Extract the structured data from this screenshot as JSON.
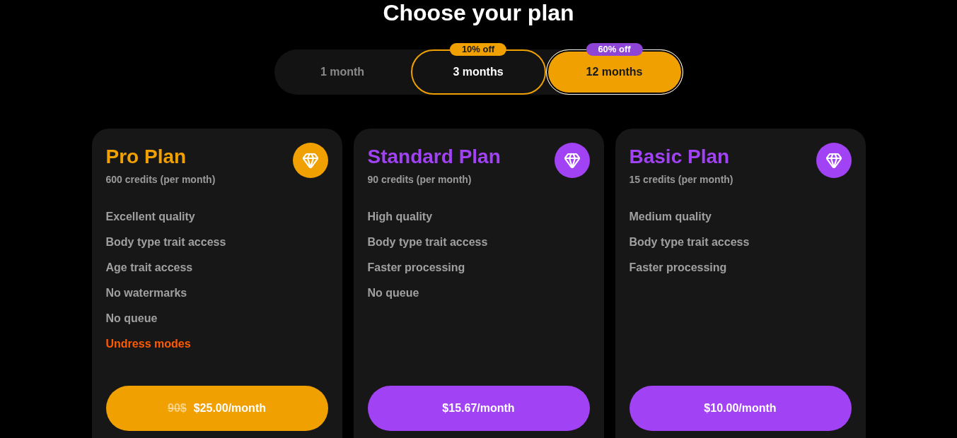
{
  "title": "Choose your plan",
  "billing_periods": [
    {
      "label": "1 month",
      "selected": false,
      "hovered": false
    },
    {
      "label": "3 months",
      "selected": false,
      "hovered": true,
      "badge": {
        "text": "10% off",
        "color": "#f0a000"
      }
    },
    {
      "label": "12 months",
      "selected": true,
      "hovered": false,
      "badge": {
        "text": "60% off",
        "color": "#8e44d6"
      }
    }
  ],
  "plans": [
    {
      "name": "Pro Plan",
      "color": "#f0a000",
      "credits": "600 credits (per month)",
      "features": [
        {
          "text": "Excellent quality",
          "highlighted": false
        },
        {
          "text": "Body type trait access",
          "highlighted": false
        },
        {
          "text": "Age trait access",
          "highlighted": false
        },
        {
          "text": "No watermarks",
          "highlighted": false
        },
        {
          "text": "No queue",
          "highlighted": false
        },
        {
          "text": "Undress modes",
          "highlighted": true
        }
      ],
      "price": {
        "original": "90$",
        "current": "$25.00/month"
      }
    },
    {
      "name": "Standard Plan",
      "color": "#a142f4",
      "credits": "90 credits (per month)",
      "features": [
        {
          "text": "High quality",
          "highlighted": false
        },
        {
          "text": "Body type trait access",
          "highlighted": false
        },
        {
          "text": "Faster processing",
          "highlighted": false
        },
        {
          "text": "No queue",
          "highlighted": false
        }
      ],
      "price": {
        "current": "$15.67/month"
      }
    },
    {
      "name": "Basic Plan",
      "color": "#a142f4",
      "credits": "15 credits (per month)",
      "features": [
        {
          "text": "Medium quality",
          "highlighted": false
        },
        {
          "text": "Body type trait access",
          "highlighted": false
        },
        {
          "text": "Faster processing",
          "highlighted": false
        }
      ],
      "price": {
        "current": "$10.00/month"
      }
    }
  ]
}
